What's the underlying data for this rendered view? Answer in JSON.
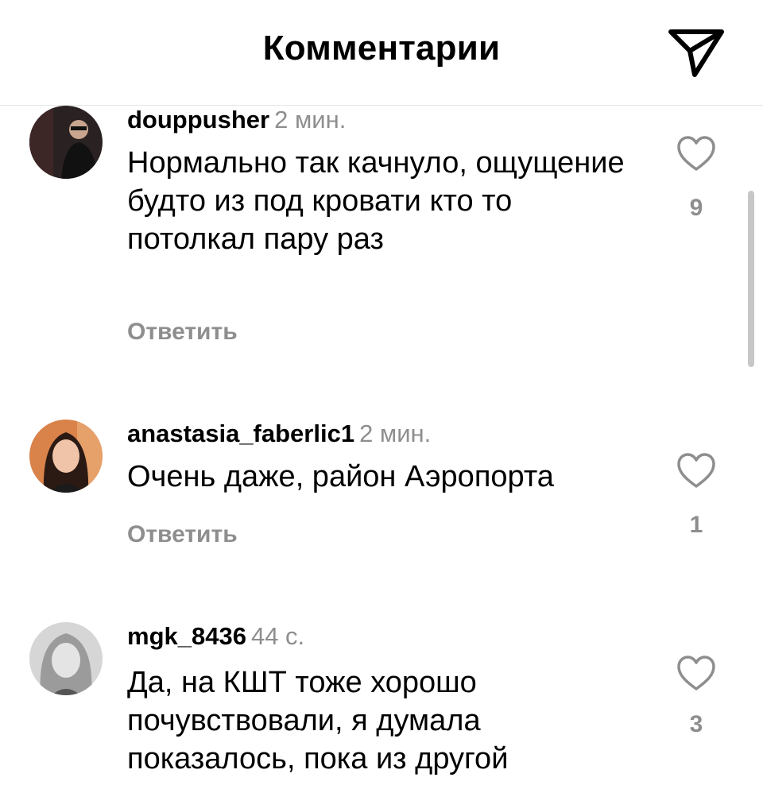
{
  "header": {
    "title": "Комментарии",
    "share_icon": "paper-plane-icon"
  },
  "comments": [
    {
      "username": "douppusher",
      "time": "2 мин.",
      "text": "Нормально так качнуло, ощущение будто из под кровати кто то потолкал пару раз",
      "reply_label": "Ответить",
      "likes": "9"
    },
    {
      "username": "anastasia_faberlic1",
      "time": "2 мин.",
      "text": "Очень даже, район Аэропорта",
      "reply_label": "Ответить",
      "likes": "1"
    },
    {
      "username": "mgk_8436",
      "time": "44 с.",
      "text": "Да, на КШТ тоже хорошо почувствовали, я думала показалось, пока из другой",
      "likes": "3"
    }
  ],
  "colors": {
    "secondary_text": "#8e8e8e",
    "divider": "#e6e6e6"
  }
}
